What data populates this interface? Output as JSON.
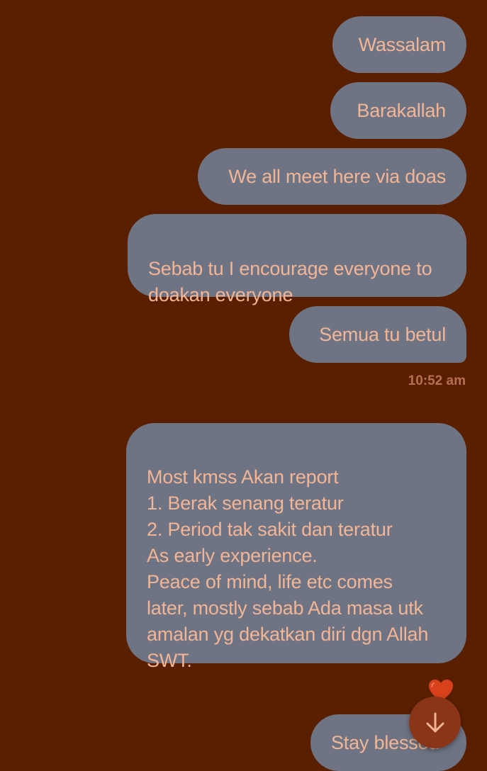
{
  "messages": {
    "m1": "Wassalam",
    "m2": "Barakallah",
    "m3": "We all meet here via doas",
    "m4": "Sebab tu I encourage everyone to\ndoakan everyone",
    "m5": "Semua tu betul",
    "m6": "Most kmss Akan report\n1. Berak senang teratur\n2. Period tak sakit dan teratur\nAs early experience.\nPeace of mind, life etc comes\nlater, mostly sebab Ada masa utk\namalan yg dekatkan diri dgn Allah\nSWT.",
    "m7": "Stay blessed"
  },
  "timestamp": "10:52 am",
  "reaction": {
    "icon": "heart-icon",
    "color": "#d9401c"
  },
  "scroll_button": {
    "icon": "arrow-down-icon"
  },
  "colors": {
    "background": "#5a1f01",
    "bubble": "#6f7484",
    "bubble_text": "#f2b595",
    "timestamp": "#b56f52"
  }
}
